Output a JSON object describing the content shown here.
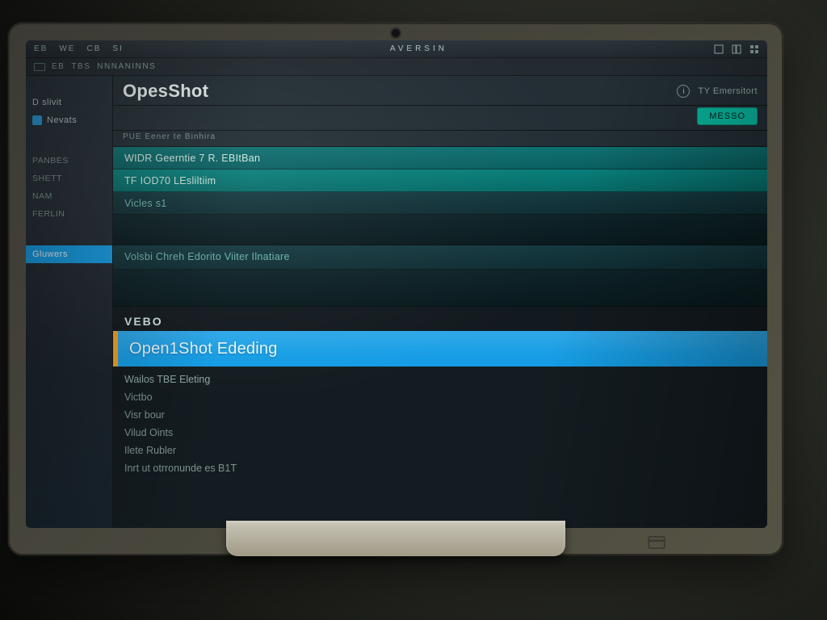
{
  "osbar": {
    "items": [
      "EB",
      "WE",
      "CB",
      "SI"
    ],
    "title": "AVERSIN",
    "right_icons": [
      "window-icon",
      "layout-icon",
      "grid-icon"
    ]
  },
  "subbar": {
    "items": [
      "EB",
      "TBS",
      "NNNANINNS"
    ]
  },
  "sidebar": {
    "groups": [
      {
        "label": "D slivit",
        "has_icon": true
      },
      {
        "label": "Nevats"
      }
    ],
    "items": [
      {
        "label": "PANBES"
      },
      {
        "label": "SHETT"
      },
      {
        "label": "NAM"
      },
      {
        "label": "FERLIN"
      }
    ],
    "active": {
      "label": "Gluwers"
    }
  },
  "app": {
    "title": "OpesShot",
    "subtitle": "PUE Eener te Binhira",
    "panel_label": "TY Emersitort",
    "panel_button": "MESSO"
  },
  "tracks": [
    {
      "text": "WIDR Geerntie 7 R. EBItBan"
    },
    {
      "text": "TF IOD70 LEsliltiim"
    },
    {
      "text": "Vicles s1"
    },
    {
      "text": "Volsbi Chreh Edorito Viiter Ilnatiare"
    }
  ],
  "section": {
    "label": "VEBO"
  },
  "highlight": {
    "title": "Open1Shot Ededing"
  },
  "lowerlist": [
    "Wailos TBE Eleting",
    "Victbo",
    "Visr bour",
    "Vilud Oints",
    "Ilete Rubler",
    "Inrt ut otrronunde es B1T"
  ]
}
